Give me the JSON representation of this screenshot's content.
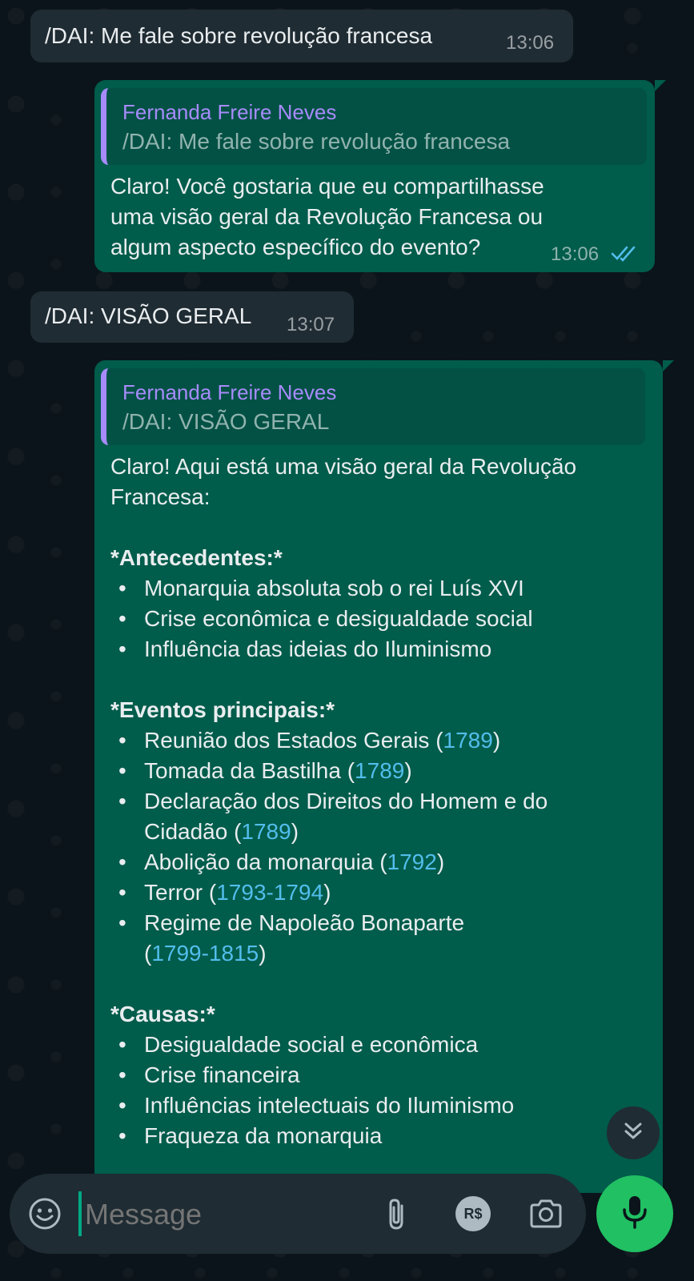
{
  "messages": {
    "m1": {
      "text": "/DAI: Me fale sobre revolução francesa",
      "time": "13:06"
    },
    "m2": {
      "quote_author": "Fernanda Freire Neves",
      "quote_text": "/DAI: Me fale sobre revolução francesa",
      "lines": [
        "Claro! Você gostaria que eu compartilhasse",
        "uma visão geral da Revolução Francesa ou",
        "algum aspecto específico do evento?"
      ],
      "time": "13:06",
      "status_icon": "double-check-read-icon"
    },
    "m3": {
      "text": "/DAI: VISÃO GERAL",
      "time": "13:07"
    },
    "m4": {
      "quote_author": "Fernanda Freire Neves",
      "quote_text": "/DAI: VISÃO GERAL",
      "intro_lines": [
        "Claro! Aqui está uma visão geral da Revolução",
        "Francesa:"
      ],
      "antecedentes": {
        "title": "*Antecedentes:*",
        "items": [
          "Monarquia absoluta sob o rei Luís XVI",
          "Crise econômica e desigualdade social",
          "Influência das ideias do Iluminismo"
        ]
      },
      "eventos": {
        "title": "*Eventos principais:*",
        "items": [
          {
            "lines": [
              {
                "text": "Reunião dos Estados Gerais (",
                "year": "1789",
                "after": ")"
              }
            ]
          },
          {
            "lines": [
              {
                "text": "Tomada da Bastilha (",
                "year": "1789",
                "after": ")"
              }
            ]
          },
          {
            "lines": [
              {
                "text": "Declaração dos Direitos do Homem e do",
                "year": "",
                "after": ""
              },
              {
                "text": "Cidadão (",
                "year": "1789",
                "after": ")"
              }
            ]
          },
          {
            "lines": [
              {
                "text": "Abolição da monarquia (",
                "year": "1792",
                "after": ")"
              }
            ]
          },
          {
            "lines": [
              {
                "text": "Terror (",
                "year": "1793-1794",
                "after": ")"
              }
            ]
          },
          {
            "lines": [
              {
                "text": "Regime de Napoleão Bonaparte",
                "year": "",
                "after": ""
              },
              {
                "text": "(",
                "year": "1799-1815",
                "after": ")"
              }
            ]
          }
        ]
      },
      "causas": {
        "title": "*Causas:*",
        "items": [
          "Desigualdade social e econômica",
          "Crise financeira",
          "Influências intelectuais do Iluminismo",
          "Fraqueza da monarquia"
        ]
      }
    }
  },
  "composer": {
    "placeholder": "Message",
    "icons": [
      "emoji-icon",
      "attach-icon",
      "payment-icon",
      "camera-icon",
      "mic-icon"
    ],
    "payment_label": "R$"
  },
  "scroll_down_icon": "double-chevron-down-icon",
  "colors": {
    "background": "#0b141a",
    "incoming_bubble": "#202c33",
    "outgoing_bubble": "#005c4b",
    "quote_accent": "#a78bfa",
    "link_year": "#53bdeb",
    "read_check": "#53bdeb",
    "mic_button": "#21c063"
  }
}
